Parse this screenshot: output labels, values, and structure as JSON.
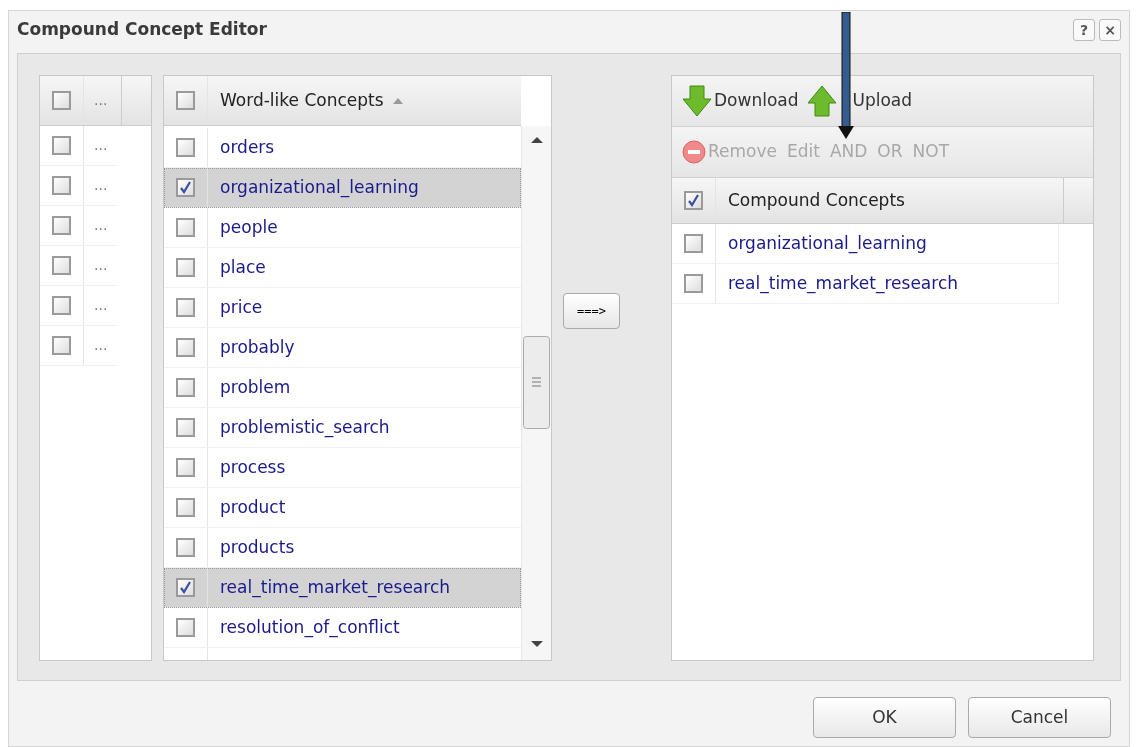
{
  "window": {
    "title": "Compound Concept Editor",
    "controls": [
      "?",
      "×"
    ]
  },
  "side_grid": {
    "header": {
      "checked": false,
      "label": "..."
    },
    "rows": [
      {
        "checked": false,
        "label": "..."
      },
      {
        "checked": false,
        "label": "..."
      },
      {
        "checked": false,
        "label": "..."
      },
      {
        "checked": false,
        "label": "..."
      },
      {
        "checked": false,
        "label": "..."
      },
      {
        "checked": false,
        "label": "..."
      }
    ]
  },
  "word_list": {
    "header": {
      "checked": false,
      "label": "Word-like Concepts",
      "sort_ascending": true
    },
    "rows": [
      {
        "label": "orders",
        "checked": false
      },
      {
        "label": "organizational_learning",
        "checked": true
      },
      {
        "label": "people",
        "checked": false
      },
      {
        "label": "place",
        "checked": false
      },
      {
        "label": "price",
        "checked": false
      },
      {
        "label": "probably",
        "checked": false
      },
      {
        "label": "problem",
        "checked": false
      },
      {
        "label": "problemistic_search",
        "checked": false
      },
      {
        "label": "process",
        "checked": false
      },
      {
        "label": "product",
        "checked": false
      },
      {
        "label": "products",
        "checked": false
      },
      {
        "label": "real_time_market_research",
        "checked": true
      },
      {
        "label": "resolution_of_conflict",
        "checked": false
      }
    ]
  },
  "move_button": "===>",
  "compound_panel": {
    "toolbar": [
      {
        "kind": "download",
        "label": "Download",
        "disabled": false
      },
      {
        "kind": "upload",
        "label": "Upload",
        "disabled": false
      }
    ],
    "actions": [
      {
        "kind": "remove",
        "label": "Remove",
        "disabled": true
      },
      {
        "kind": "text",
        "label": "Edit",
        "disabled": true
      },
      {
        "kind": "text",
        "label": "AND",
        "disabled": true
      },
      {
        "kind": "text",
        "label": "OR",
        "disabled": true
      },
      {
        "kind": "text",
        "label": "NOT",
        "disabled": true
      }
    ],
    "header": {
      "checked": true,
      "label": "Compound Concepts"
    },
    "rows": [
      {
        "label": "organizational_learning",
        "checked": false
      },
      {
        "label": "real_time_market_research",
        "checked": false
      }
    ]
  },
  "buttons": [
    "OK",
    "Cancel"
  ]
}
